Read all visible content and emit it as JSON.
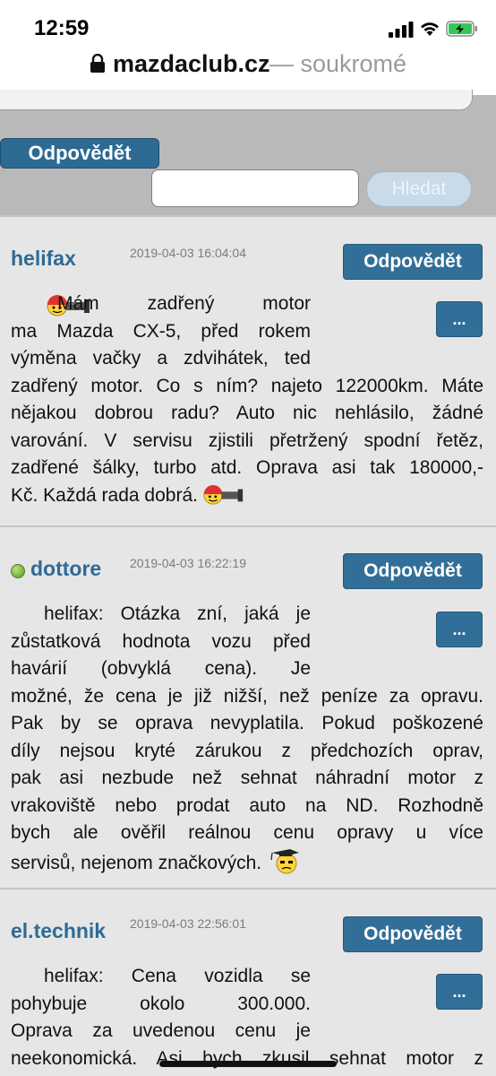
{
  "status_bar": {
    "time": "12:59"
  },
  "browser": {
    "domain": "mazdaclub.cz",
    "mode": "— soukromé"
  },
  "form": {
    "reply_label": "Odpovědět",
    "search_placeholder": "",
    "search_button": "Hledat"
  },
  "posts": [
    {
      "author": "helifax",
      "date": "2019-04-03 16:04:04",
      "online": false,
      "reply_label": "Odpovědět",
      "more_label": "...",
      "lines_narrow": [
        "Mám zadřený motor",
        "ma Mazda CX-5, před rokem",
        "výměna vačky a zdvihátek, ted"
      ],
      "lines": [
        "zadřený motor. Co s ním? najeto 122000km. Máte",
        "nějakou dobrou radu? Auto nic nehlásilo, žádné",
        "varování. V servisu zjistili přetržený spodní řetěz,",
        "zadřené šálky, turbo atd. Oprava asi tak 180000,-"
      ],
      "last_line": "Kč. Každá rada dobrá."
    },
    {
      "author": "dottore",
      "date": "2019-04-03 16:22:19",
      "online": true,
      "reply_label": "Odpovědět",
      "more_label": "...",
      "lines_narrow": [
        "helifax: Otázka zní, jaká je",
        "zůstatková hodnota vozu před",
        "havárií (obvyklá cena). Je"
      ],
      "lines": [
        "možné, že cena je již nižší, než peníze za opravu.",
        "Pak by se oprava nevyplatila. Pokud poškozené",
        "díly nejsou kryté zárukou z předchozích oprav,",
        "pak asi nezbude než sehnat náhradní motor z",
        "vrakoviště nebo prodat auto na ND. Rozhodně",
        "bych ale ověřil reálnou cenu opravy u více"
      ],
      "last_line": "servisů, nejenom značkových."
    },
    {
      "author": "el.technik",
      "date": "2019-04-03 22:56:01",
      "online": false,
      "reply_label": "Odpovědět",
      "more_label": "...",
      "lines_narrow": [
        "helifax: Cena vozidla se",
        "pohybuje okolo 300.000.",
        "Oprava za uvedenou cenu je"
      ],
      "lines": [
        "neekonomická. Asi bych zkusil sehnat motor z"
      ],
      "last_line": ""
    }
  ],
  "icons": {
    "lock": "lock-icon",
    "signal": "cellular-signal-icon",
    "wifi": "wifi-icon",
    "battery": "battery-charging-icon",
    "smiley_bounce": "smiley-binoculars-icon",
    "smiley_grad": "smiley-graduate-icon"
  },
  "colors": {
    "accent": "#2e6b95",
    "button": "#326f98",
    "post_bg": "#e6e6e6",
    "form_bg": "#b9b9b9",
    "online": "#5a9a1e"
  }
}
